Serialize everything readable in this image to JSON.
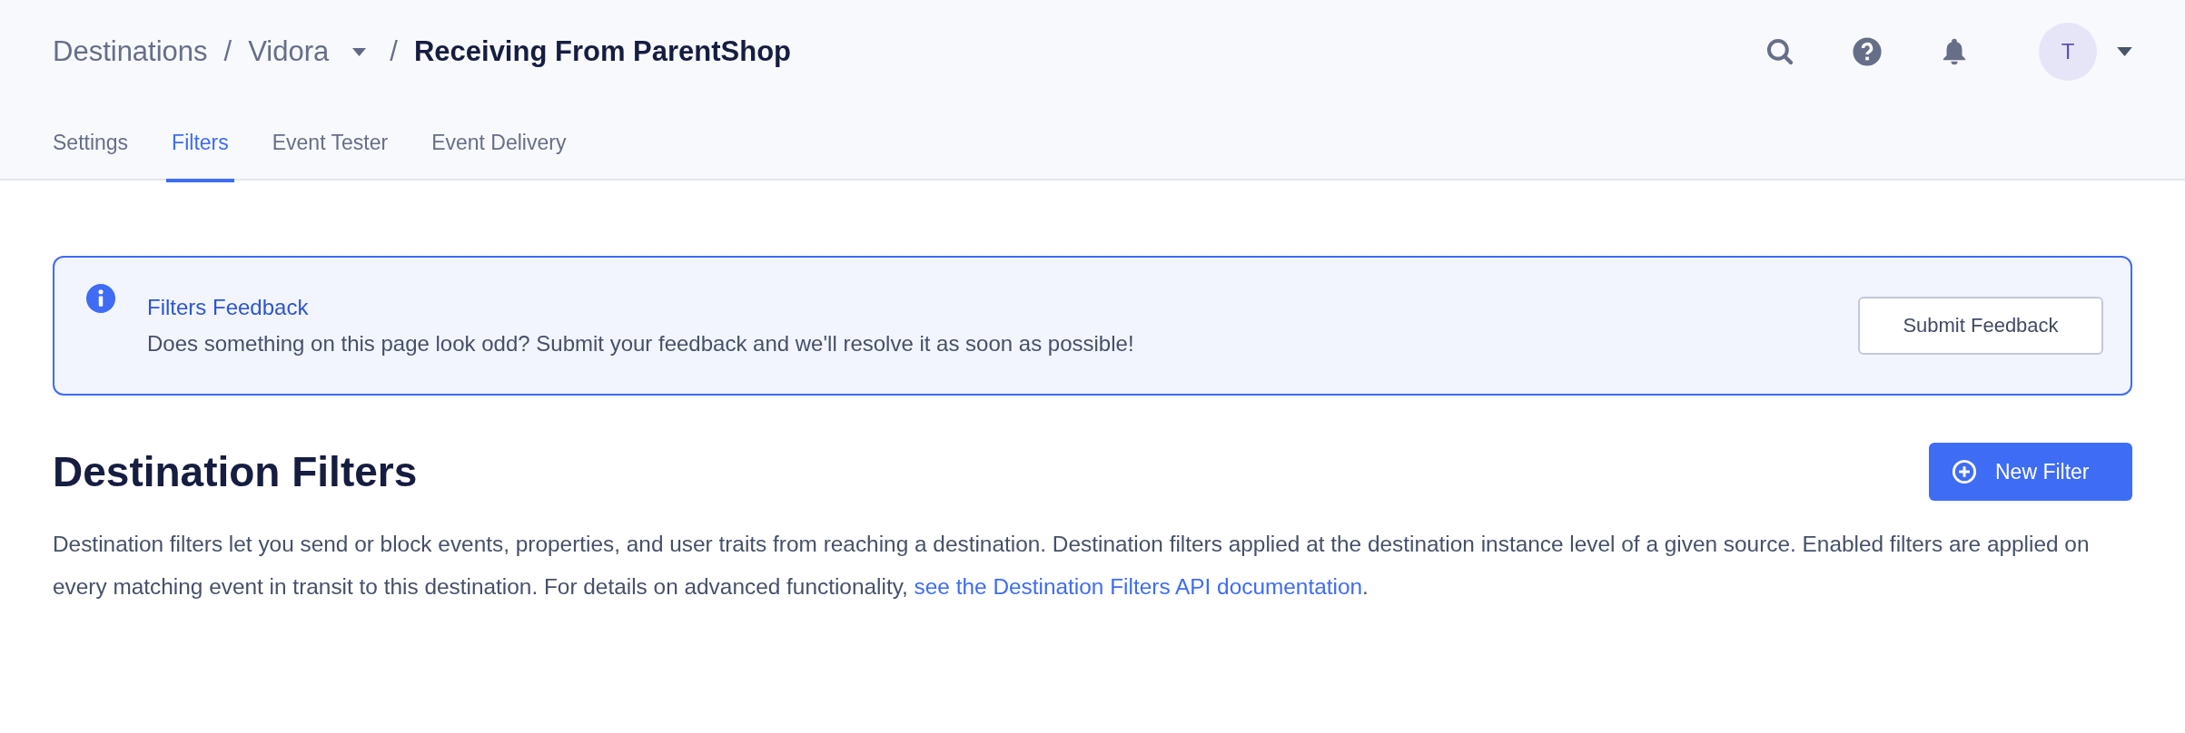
{
  "breadcrumb": {
    "items": [
      {
        "label": "Destinations",
        "kind": "link"
      },
      {
        "label": "Vidora",
        "kind": "dropdown"
      },
      {
        "label": "Receiving From ParentShop",
        "kind": "current"
      }
    ],
    "separator": "/"
  },
  "header_actions": {
    "avatar": "T"
  },
  "tabs": [
    {
      "label": "Settings",
      "selected": false
    },
    {
      "label": "Filters",
      "selected": true
    },
    {
      "label": "Event Tester",
      "selected": false
    },
    {
      "label": "Event Delivery",
      "selected": false
    }
  ],
  "banner": {
    "title": "Filters Feedback",
    "message": "Does something on this page look odd? Submit your feedback and we'll resolve it as soon as possible!",
    "button": "Submit Feedback"
  },
  "section": {
    "title": "Destination Filters",
    "button": "New Filter",
    "description": "Destination filters let you send or block events, properties, and user traits from reaching a destination. Destination filters applied at the destination instance level of a given source. Enabled filters are applied on every matching event in transit to this destination. For details on advanced functionality, ",
    "link": "see the Destination Filters API documentation",
    "suffix": "."
  }
}
